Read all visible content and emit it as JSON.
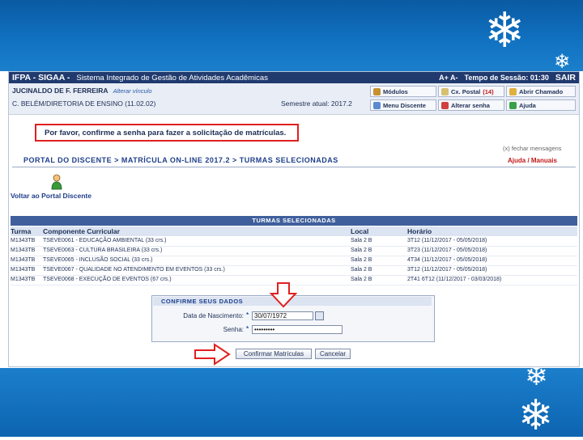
{
  "header": {
    "title": "IFPA - SIGAA -",
    "system_name": "Sistema Integrado de Gestão de Atividades Acadêmicas",
    "font_controls": "A+ A-",
    "session_label": "Tempo de Sessão: 01:30",
    "logout_label": "SAIR"
  },
  "user": {
    "name": "JUCINALDO DE F. FERREIRA",
    "change_link": "Alterar vínculo",
    "unit": "C. BELÉM/DIRETORIA DE ENSINO (11.02.02)",
    "semester": "Semestre atual: 2017.2"
  },
  "menu": {
    "modulos": "Módulos",
    "caixa_postal": "Cx. Postal",
    "caixa_postal_count": "(14)",
    "abrir_chamado": "Abrir Chamado",
    "menu_discente": "Menu Discente",
    "alterar_senha": "Alterar senha",
    "ajuda": "Ajuda"
  },
  "message": "Por favor, confirme a senha para fazer a solicitação de matrículas.",
  "fechar": "(x) fechar mensagens",
  "breadcrumb": "PORTAL DO DISCENTE > MATRÍCULA ON-LINE 2017.2 > TURMAS SELECIONADAS",
  "help_links": "Ajuda / Manuais",
  "voltar": "Voltar ao Portal Discente",
  "table": {
    "title": "TURMAS SELECIONADAS",
    "headers": [
      "Turma",
      "Componente Curricular",
      "Local",
      "Horário"
    ],
    "rows": [
      [
        "M1343TB",
        "TSEVE0061 - EDUCAÇÃO AMBIENTAL (33 crs.)",
        "Sala 2 B",
        "3T12 (11/12/2017 - 05/05/2018)"
      ],
      [
        "M1343TB",
        "TSEVE0063 - CULTURA BRASILEIRA (33 crs.)",
        "Sala 2 B",
        "3T23 (11/12/2017 - 05/05/2018)"
      ],
      [
        "M1343TB",
        "TSEVE0065 - INCLUSÃO SOCIAL (33 crs.)",
        "Sala 2 B",
        "4T34 (11/12/2017 - 05/05/2018)"
      ],
      [
        "M1343TB",
        "TSEVE0067 - QUALIDADE NO ATENDIMENTO EM EVENTOS (33 crs.)",
        "Sala 2 B",
        "3T12 (11/12/2017 - 05/05/2018)"
      ],
      [
        "M1343TB",
        "TSEVE0068 - EXECUÇÃO DE EVENTOS (67 crs.)",
        "Sala 2 B",
        "2T41 6T12 (11/12/2017 - 03/03/2018)"
      ]
    ]
  },
  "form": {
    "title": "CONFIRME SEUS DADOS",
    "birth_label": "Data de Nascimento:",
    "birth_value": "30/07/1972",
    "password_label": "Senha:",
    "password_value": "•••••••••",
    "required_mark": "*"
  },
  "buttons": {
    "confirm": "Confirmar Matrículas",
    "cancel": "Cancelar"
  },
  "colors": {
    "accent_blue": "#203a6e",
    "highlight_red": "#e02020"
  }
}
